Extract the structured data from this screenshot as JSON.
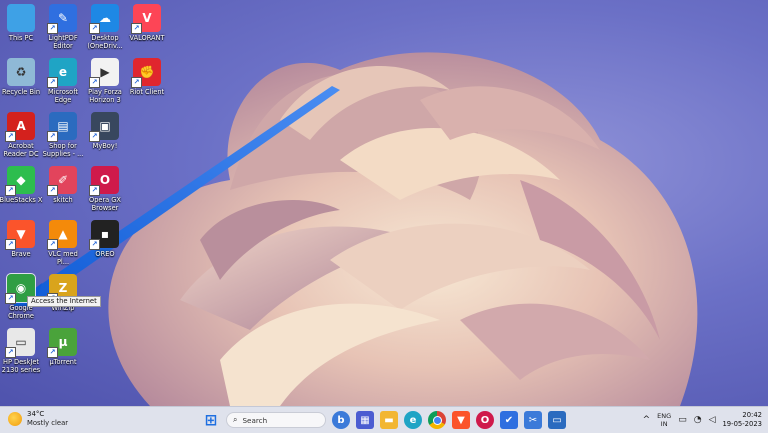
{
  "desktop_icons": [
    {
      "name": "this-pc",
      "label": "This PC",
      "glyph": "",
      "color": "#3ea1e6",
      "shortcut": false
    },
    {
      "name": "lightpdf-editor",
      "label": "LightPDF\nEditor",
      "glyph": "✎",
      "color": "#2f6fe0",
      "shortcut": true
    },
    {
      "name": "desktop-onedrive",
      "label": "Desktop\n(OneDriv...",
      "glyph": "☁",
      "color": "#1e88e5",
      "shortcut": true
    },
    {
      "name": "valorant",
      "label": "VALORANT",
      "glyph": "V",
      "color": "#fd4556",
      "shortcut": true
    },
    {
      "name": "recycle-bin",
      "label": "Recycle Bin",
      "glyph": "♻",
      "color": "#8fb9d6",
      "shortcut": false
    },
    {
      "name": "microsoft-edge",
      "label": "Microsoft\nEdge",
      "glyph": "e",
      "color": "#1fa4c5",
      "shortcut": true
    },
    {
      "name": "play-forza-horizon-3",
      "label": "Play Forza\nHorizon 3",
      "glyph": "▶",
      "color": "#f2f2f2",
      "shortcut": true
    },
    {
      "name": "riot-client",
      "label": "Riot Client",
      "glyph": "✊",
      "color": "#e0262e",
      "shortcut": true
    },
    {
      "name": "acrobat-reader-dc",
      "label": "Acrobat\nReader DC",
      "glyph": "A",
      "color": "#d4211d",
      "shortcut": true
    },
    {
      "name": "shop-for-supplies",
      "label": "Shop for\nSupplies - ...",
      "glyph": "▤",
      "color": "#2b6bbf",
      "shortcut": true
    },
    {
      "name": "myboy",
      "label": "MyBoy!",
      "glyph": "▣",
      "color": "#38475e",
      "shortcut": true
    },
    {
      "name": "bluestacks-x",
      "label": "BlueStacks X",
      "glyph": "◆",
      "color": "#2dbd4e",
      "shortcut": true
    },
    {
      "name": "skitch",
      "label": "skitch",
      "glyph": "✐",
      "color": "#e2445c",
      "shortcut": true
    },
    {
      "name": "opera-gx-browser",
      "label": "Opera GX\nBrowser",
      "glyph": "O",
      "color": "#cf1a4b",
      "shortcut": true
    },
    {
      "name": "brave",
      "label": "Brave",
      "glyph": "▼",
      "color": "#fb542b",
      "shortcut": true
    },
    {
      "name": "vlc-media",
      "label": "VLC med\nPl...",
      "glyph": "▲",
      "color": "#f48a0a",
      "shortcut": true
    },
    {
      "name": "oreo",
      "label": "OREO",
      "glyph": "▪",
      "color": "#222222",
      "shortcut": true
    },
    {
      "name": "google-chrome",
      "label": "Google\nChrome",
      "glyph": "◉",
      "color": "#2f9e44",
      "shortcut": true
    },
    {
      "name": "winzip",
      "label": "WinZip",
      "glyph": "Z",
      "color": "#d9a41c",
      "shortcut": true
    },
    {
      "name": "hp-deskjet",
      "label": "HP DeskJet\n2130 series",
      "glyph": "▭",
      "color": "#e8e8e8",
      "shortcut": true
    },
    {
      "name": "utorrent",
      "label": "µTorrent",
      "glyph": "µ",
      "color": "#4aa33b",
      "shortcut": true
    }
  ],
  "tooltip": {
    "text": "Access the Internet"
  },
  "taskbar": {
    "weather": {
      "temp": "34°C",
      "condition": "Mostly clear"
    },
    "search_label": "Search",
    "apps": [
      {
        "name": "start-button",
        "glyph": "⊞",
        "color": "#1f6fe0"
      },
      {
        "name": "search",
        "glyph": "",
        "color": ""
      },
      {
        "name": "bing-chat",
        "glyph": "b",
        "color": "#3b7ad9"
      },
      {
        "name": "microsoft-store",
        "glyph": "▦",
        "color": "#4b5cd1"
      },
      {
        "name": "file-explorer",
        "glyph": "▬",
        "color": "#f2b632"
      },
      {
        "name": "edge",
        "glyph": "e",
        "color": "#1fa4c5"
      },
      {
        "name": "chrome",
        "glyph": "◉",
        "color": "#2f9e44"
      },
      {
        "name": "brave",
        "glyph": "▼",
        "color": "#fb542b"
      },
      {
        "name": "opera",
        "glyph": "O",
        "color": "#cf1a4b"
      },
      {
        "name": "to-do",
        "glyph": "✔",
        "color": "#2f6fe0"
      },
      {
        "name": "snipping-tool",
        "glyph": "✂",
        "color": "#3b7ad9"
      },
      {
        "name": "hp-smart",
        "glyph": "▭",
        "color": "#2b6bbf"
      }
    ],
    "tray": {
      "chevron": "^",
      "lang": "ENG",
      "region": "IN",
      "time": "20:42",
      "date": "19-05-2023"
    }
  }
}
